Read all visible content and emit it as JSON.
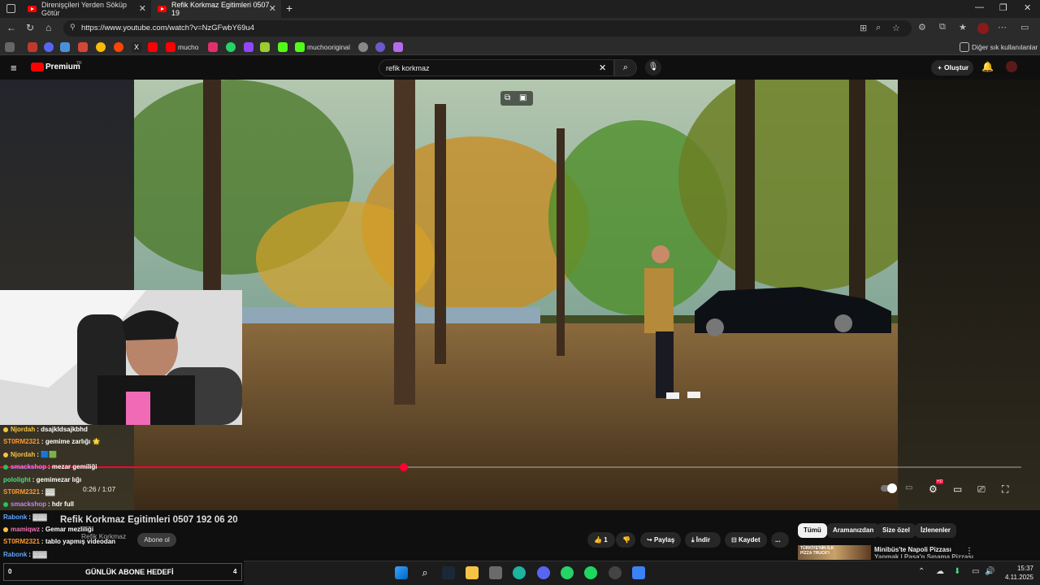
{
  "browser": {
    "tabs": [
      {
        "label": "Direnişçileri Yerden Söküp Götür"
      },
      {
        "label": "Refik Korkmaz Egitimleri 0507 19"
      }
    ],
    "url": "https://www.youtube.com/watch?v=NzGFwbY69u4",
    "new_tab": "+",
    "bookmarks": [
      {
        "label": "mucho"
      },
      {
        "label": "muchooriginal"
      }
    ],
    "other_bookmarks": "Diğer sık kullanılanlar",
    "window_controls": [
      "—",
      "❐",
      "✕"
    ]
  },
  "youtube": {
    "logo_text": "Premium",
    "logo_sup": "TR",
    "search_value": "refik korkmaz",
    "create_label": "Oluştur"
  },
  "player": {
    "time": "0:26 / 1:07",
    "progress_fraction": 0.395,
    "hd_badge": "HD"
  },
  "video": {
    "title": "Refik Korkmaz Egitimleri 0507 192 06 20",
    "channel": "Refik Korkmaz",
    "subscribe": "Abone ol",
    "actions": {
      "like_count": "1",
      "share": "Paylaş",
      "download": "İndir",
      "save": "Kaydet",
      "more": "..."
    }
  },
  "chips": [
    "Tümü",
    "Aramanızdan",
    "Size özel",
    "İzlenenler"
  ],
  "suggestion": {
    "title_line1": "Minibüs'te Napoli Pizzası",
    "title_line2": "Yapmak | Paşa'n Sınama Pizzası",
    "thumb_text": "TÜRKİYE'NİN İLK PİZZA TRUCK'I"
  },
  "chat": [
    {
      "user": "Njordah",
      "text": "dsajkldsajkbhd",
      "color": "#f5c542",
      "dot": "#f5c542"
    },
    {
      "user": "ST0RM2321",
      "text": "gemime zarlığı 🌟",
      "color": "#ff9a2e",
      "dot": ""
    },
    {
      "user": "Njordah",
      "text": "🟦🟩",
      "color": "#f5c542",
      "dot": "#f5c542"
    },
    {
      "user": "smackshop",
      "text": "mezar gemiliği",
      "color": "#c084fc",
      "dot": "#22c55e"
    },
    {
      "user": "pololight",
      "text": "gemimezar lığı",
      "color": "#4ade80",
      "dot": ""
    },
    {
      "user": "ST0RM2321",
      "text": "▓▓",
      "color": "#ff9a2e",
      "dot": ""
    },
    {
      "user": "smackshop",
      "text": "hdr full",
      "color": "#c084fc",
      "dot": "#22c55e"
    },
    {
      "user": "Rabonk",
      "text": "▓▓▓",
      "color": "#60a5fa",
      "dot": ""
    },
    {
      "user": "mamiqwz",
      "text": "Gemar mezliliği",
      "color": "#f472b6",
      "dot": "#f5c542"
    },
    {
      "user": "ST0RM2321",
      "text": "tablo yapmış videodan",
      "color": "#ff9a2e",
      "dot": ""
    },
    {
      "user": "Rabonk",
      "text": "▓▓▓",
      "color": "#60a5fa",
      "dot": ""
    }
  ],
  "goal": {
    "label": "GÜNLÜK ABONE HEDEFİ",
    "left": "0",
    "right": "4"
  },
  "taskbar": {
    "time": "15:37",
    "date": "4.11.2025"
  },
  "colors": {
    "accent": "#ff0033",
    "background": "#0f0f0f"
  }
}
